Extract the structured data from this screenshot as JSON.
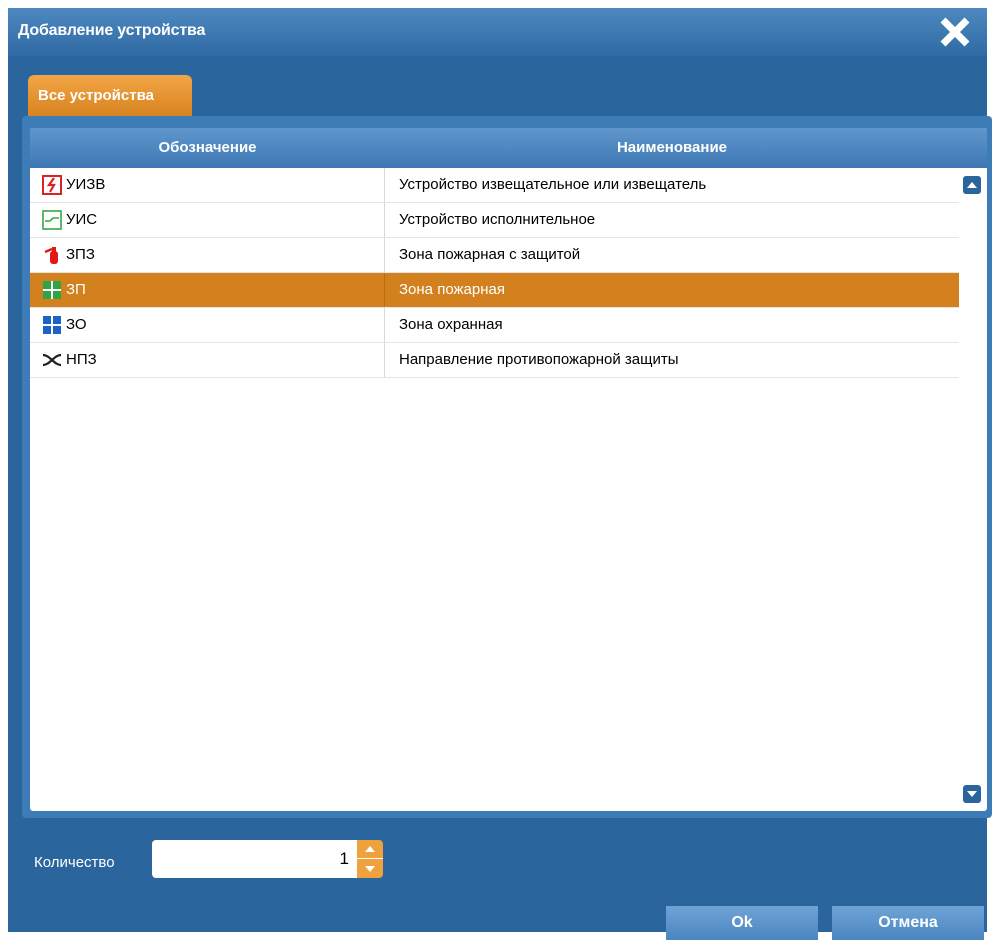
{
  "window": {
    "title": "Добавление устройства"
  },
  "tabs": [
    {
      "label": "Все устройства",
      "active": true
    }
  ],
  "table": {
    "columns": [
      "Обозначение",
      "Наименование"
    ],
    "rows": [
      {
        "code": "УИЗВ",
        "name": "Устройство извещательное или извещатель",
        "icon": "detector-icon"
      },
      {
        "code": "УИС",
        "name": "Устройство исполнительное",
        "icon": "actuator-icon"
      },
      {
        "code": "ЗПЗ",
        "name": "Зона пожарная с защитой",
        "icon": "fire-extinguisher-icon"
      },
      {
        "code": "ЗП",
        "name": "Зона пожарная",
        "icon": "fire-zone-icon",
        "selected": true
      },
      {
        "code": "ЗО",
        "name": "Зона охранная",
        "icon": "security-zone-icon"
      },
      {
        "code": "НПЗ",
        "name": "Направление противопожарной защиты",
        "icon": "direction-icon"
      }
    ]
  },
  "quantity": {
    "label": "Количество",
    "value": "1"
  },
  "buttons": {
    "ok": "Ok",
    "cancel": "Отмена"
  },
  "colors": {
    "window": "#2a659e",
    "accent": "#d3801f",
    "header": "#4a83bf"
  }
}
